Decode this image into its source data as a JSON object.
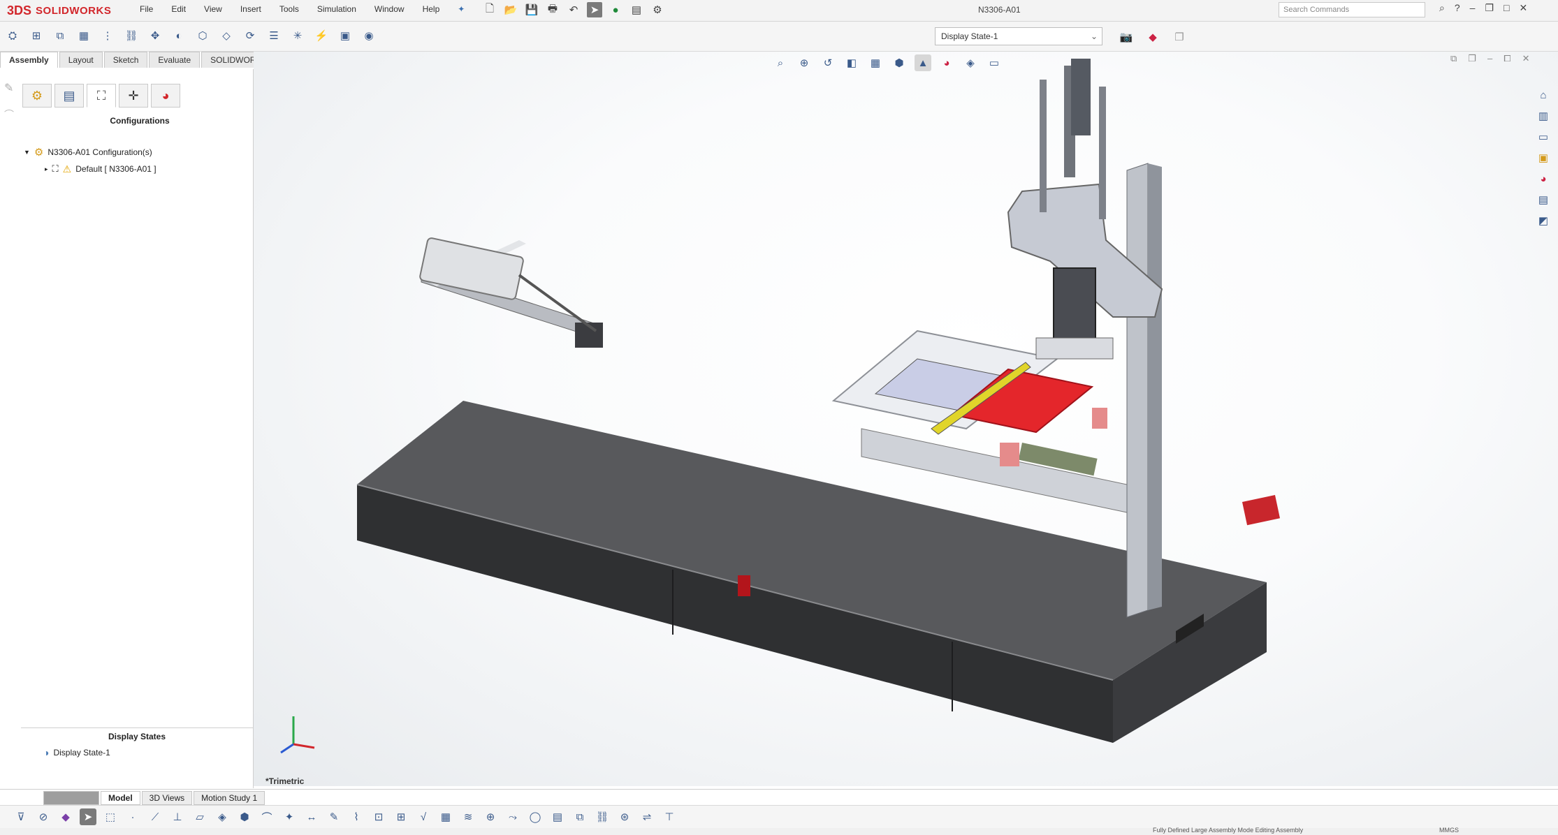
{
  "app": {
    "brand": "SOLIDWORKS",
    "brand_mark": "3DS",
    "document_title": "N3306-A01",
    "accent_color": "#d2262b"
  },
  "menu": [
    "File",
    "Edit",
    "View",
    "Insert",
    "Tools",
    "Simulation",
    "Window",
    "Help"
  ],
  "search": {
    "placeholder": "Search Commands"
  },
  "toolbar": {
    "display_state_select": "Display State-1"
  },
  "command_tabs": [
    {
      "label": "Assembly",
      "active": true
    },
    {
      "label": "Layout",
      "active": false
    },
    {
      "label": "Sketch",
      "active": false
    },
    {
      "label": "Evaluate",
      "active": false
    },
    {
      "label": "SOLIDWORKS MBD",
      "active": false
    }
  ],
  "manager_tabs": [
    "feature-manager-icon",
    "property-manager-icon",
    "configuration-manager-icon",
    "dimxpert-icon",
    "display-manager-icon"
  ],
  "config_panel": {
    "title": "Configurations",
    "root": "N3306-A01 Configuration(s)",
    "child": "Default [ N3306-A01 ]"
  },
  "display_states": {
    "title": "Display States",
    "item": "Display State-1"
  },
  "viewport": {
    "view_label": "*Trimetric"
  },
  "bottom_tabs": [
    {
      "label": "",
      "active": false
    },
    {
      "label": "Model",
      "active": true
    },
    {
      "label": "3D Views",
      "active": false
    },
    {
      "label": "Motion Study 1",
      "active": false
    }
  ],
  "status": {
    "text": "Fully Defined   Large Assembly Mode   Editing Assembly",
    "units": "MMGS"
  }
}
